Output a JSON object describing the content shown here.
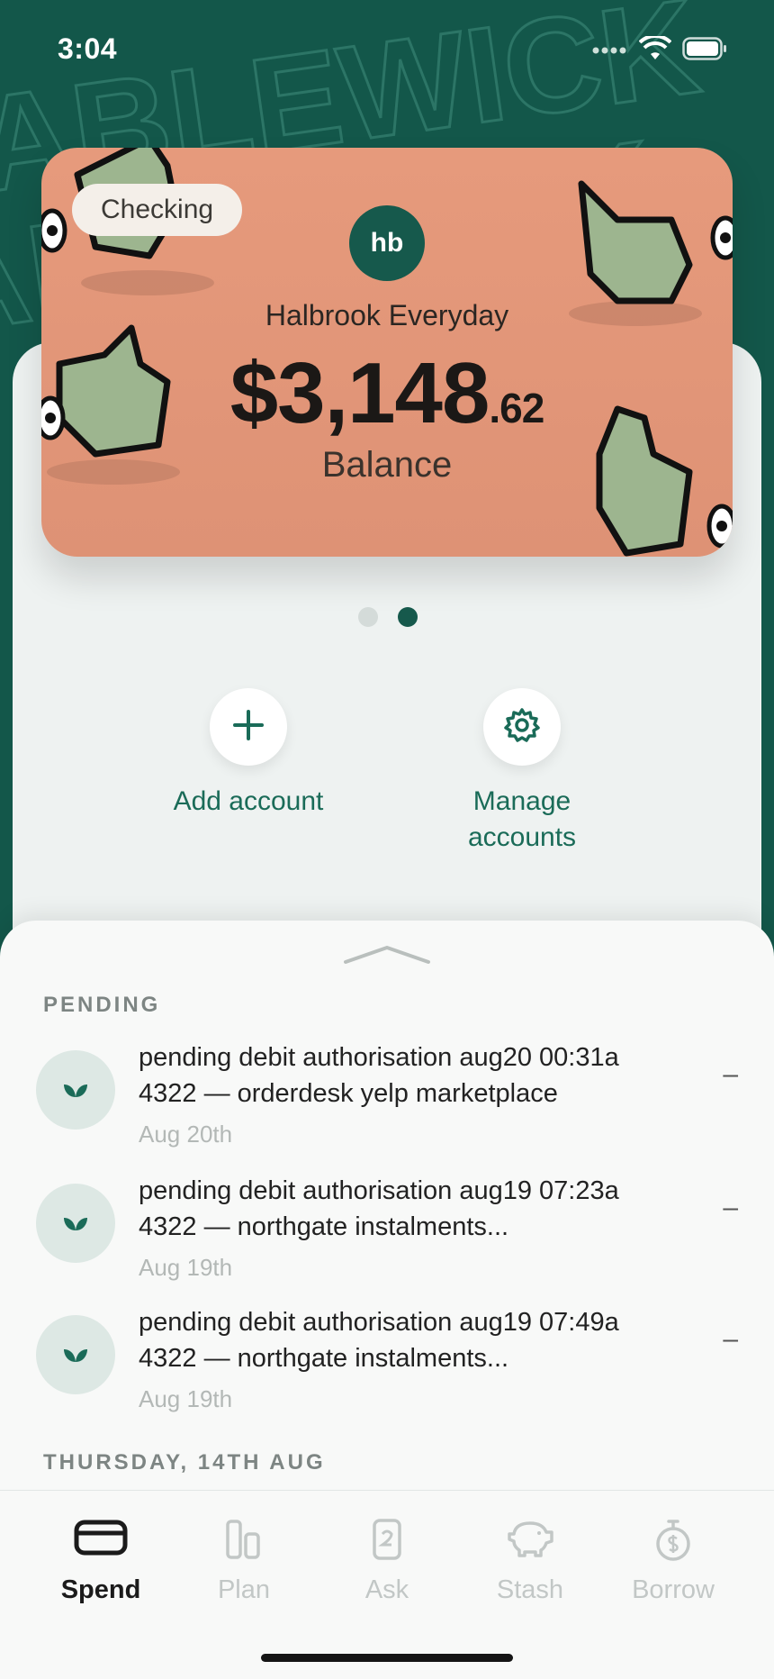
{
  "status_bar": {
    "time": "3:04"
  },
  "background": {
    "watermark_text": "ABLEWICK"
  },
  "card": {
    "type_chip": "Checking",
    "logo_text": "hb",
    "bank_name": "Halbrook Everyday",
    "balance_dollars": "$3,148",
    "balance_cents": ".62",
    "balance_label": "Balance",
    "color": "#e69a7c"
  },
  "pager": {
    "total": 2,
    "active_index": 1
  },
  "actions": {
    "add_account": "Add account",
    "manage_accounts_line1": "Manage",
    "manage_accounts_line2": "accounts"
  },
  "sheet": {
    "pending_title": "PENDING",
    "transactions": [
      {
        "line1": "pending debit authorisation aug20 00:31a",
        "line2": "4322 — orderdesk yelp marketplace",
        "date": "Aug 20th",
        "amount": "–",
        "icon": "sprout-icon"
      },
      {
        "line1": "pending debit authorisation aug19 07:23a",
        "line2": "4322 — northgate instalments...",
        "date": "Aug 19th",
        "amount": "–",
        "icon": "sprout-icon"
      },
      {
        "line1": "pending debit authorisation aug19 07:49a",
        "line2": "4322 — northgate instalments...",
        "date": "Aug 19th",
        "amount": "–",
        "icon": "sprout-icon"
      }
    ],
    "next_section_title": "THURSDAY, 14TH AUG"
  },
  "tabs": [
    {
      "label": "Spend",
      "icon": "card-icon",
      "active": true
    },
    {
      "label": "Plan",
      "icon": "bars-icon",
      "active": false
    },
    {
      "label": "Ask",
      "icon": "phone-chat-icon",
      "active": false
    },
    {
      "label": "Stash",
      "icon": "piggy-bank-icon",
      "active": false
    },
    {
      "label": "Borrow",
      "icon": "stopwatch-dollar-icon",
      "active": false
    }
  ],
  "colors": {
    "brand_green": "#13574a",
    "accent_green": "#1a6b58",
    "panel": "#eef2f1"
  }
}
